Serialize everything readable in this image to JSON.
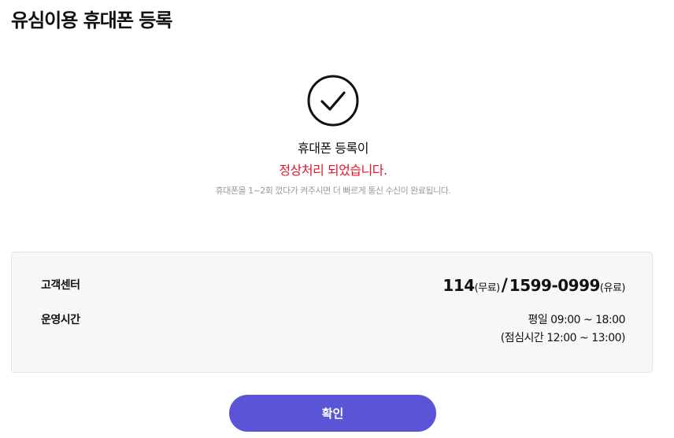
{
  "header": {
    "title": "유심이용 휴대폰 등록"
  },
  "result": {
    "icon": "check-circle-icon",
    "line1": "휴대폰 등록이",
    "line2": "정상처리 되었습니다.",
    "note": "휴대폰을 1~2회 껐다가 켜주시면 더 빠르게 통신 수신이 완료됩니다."
  },
  "info": {
    "customer_center": {
      "label": "고객센터",
      "free_number": "114",
      "free_note": "(무료)",
      "separator": "/",
      "paid_number": "1599-0999",
      "paid_note": "(유료)"
    },
    "hours": {
      "label": "운영시간",
      "weekday": "평일 09:00 ~ 18:00",
      "lunch": "(점심시간 12:00 ~ 13:00)"
    }
  },
  "footer": {
    "confirm_label": "확인"
  },
  "colors": {
    "accent": "#5a55d6",
    "alert": "#e0142a"
  }
}
